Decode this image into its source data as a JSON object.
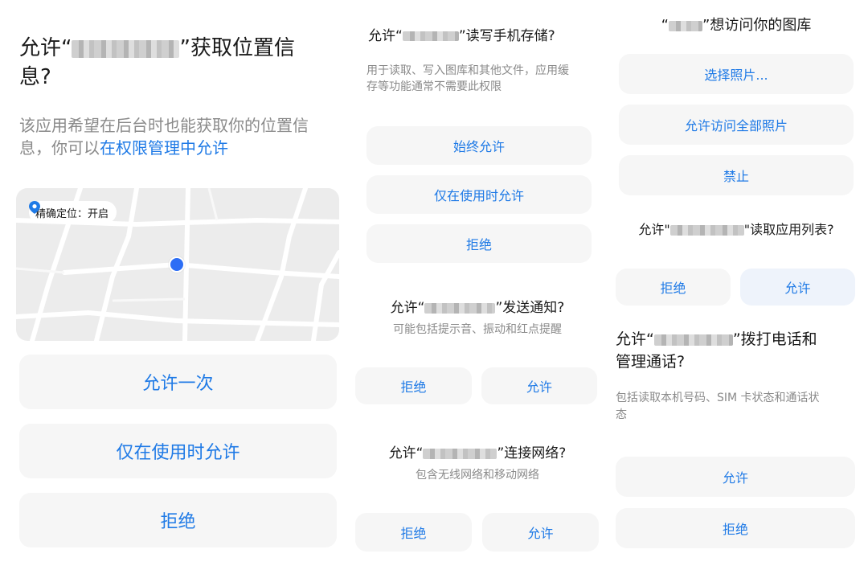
{
  "panel1": {
    "title_prefix": "允许“",
    "title_suffix": "”获取位置信",
    "title_line2": "息?",
    "desc_line1": "该应用希望在后台时也能获取你的位置信",
    "desc_line2_prefix": "息，你可以",
    "desc_link": "在权限管理中允许",
    "map_badge": "精确定位：开启",
    "btn_once": "允许一次",
    "btn_while_using": "仅在使用时允许",
    "btn_deny": "拒绝"
  },
  "panel2": {
    "storage": {
      "title_prefix": "允许“",
      "title_suffix": "”读写手机存储?",
      "desc_line1": "用于读取、写入图库和其他文件，应用缓",
      "desc_line2": "存等功能通常不需要此权限",
      "btn_always": "始终允许",
      "btn_while_using": "仅在使用时允许",
      "btn_deny": "拒绝"
    },
    "notify": {
      "title_prefix": "允许“",
      "title_suffix": "”发送通知?",
      "desc": "可能包括提示音、振动和红点提醒",
      "btn_deny": "拒绝",
      "btn_allow": "允许"
    },
    "network": {
      "title_prefix": "允许“",
      "title_suffix": "”连接网络?",
      "desc": "包含无线网络和移动网络",
      "btn_deny": "拒绝",
      "btn_allow": "允许"
    }
  },
  "panel3": {
    "gallery": {
      "title_prefix": "“",
      "title_suffix": "”想访问你的图库",
      "btn_select": "选择照片...",
      "btn_all": "允许访问全部照片",
      "btn_forbid": "禁止"
    },
    "applist": {
      "title_prefix": "允许\"",
      "title_suffix": "\"读取应用列表?",
      "btn_deny": "拒绝",
      "btn_allow": "允许"
    },
    "phone": {
      "title_prefix": "允许“",
      "title_suffix": "”拨打电话和",
      "title_line2": "管理通话?",
      "desc_line1": "包括读取本机号码、SIM 卡状态和通话状",
      "desc_line2": "态",
      "btn_allow": "允许",
      "btn_deny": "拒绝"
    }
  },
  "colors": {
    "accent": "#1f7ae6",
    "button_bg": "#f6f6f6",
    "button_bg_highlight": "#eef3fb",
    "map_bg": "#ececec",
    "location_dot": "#2d6ef5"
  },
  "icons": {
    "map_pin": "location-pin-icon"
  }
}
